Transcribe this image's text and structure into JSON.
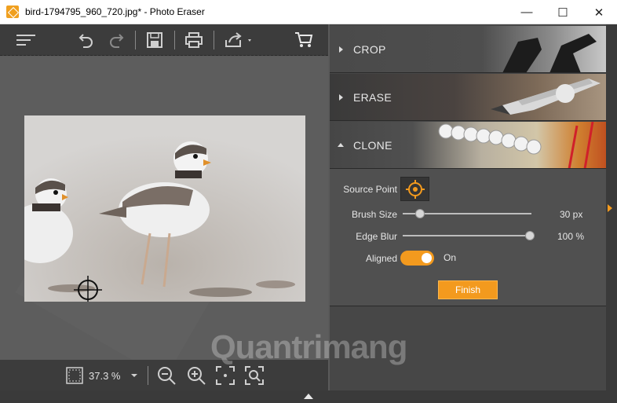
{
  "window": {
    "title": "bird-1794795_960_720.jpg* - Photo Eraser",
    "minimize": "—",
    "maximize": "☐",
    "close": "✕"
  },
  "toolbar": {
    "icons": [
      "menu-icon",
      "undo-icon",
      "redo-icon",
      "save-icon",
      "print-icon",
      "share-icon",
      "cart-icon"
    ]
  },
  "zoom": {
    "value": "37.3 %",
    "icons": [
      "fit-icon",
      "zoom-out-icon",
      "zoom-in-icon",
      "actual-size-icon",
      "zoom-selection-icon"
    ]
  },
  "panel": {
    "sections": [
      {
        "label": "CROP"
      },
      {
        "label": "ERASE"
      },
      {
        "label": "CLONE"
      }
    ],
    "clone": {
      "source_point_label": "Source Point",
      "brush_size_label": "Brush Size",
      "brush_size_value": "30 px",
      "brush_size_level": 0.0,
      "edge_blur_label": "Edge Blur",
      "edge_blur_value": "100 %",
      "edge_blur_level": 1.0,
      "aligned_label": "Aligned",
      "aligned_state": "On",
      "finish_label": "Finish"
    }
  },
  "colors": {
    "accent": "#f39a1e",
    "panel": "#474747",
    "toolbar": "#3c3c3c"
  },
  "watermark": "Quantrimang"
}
